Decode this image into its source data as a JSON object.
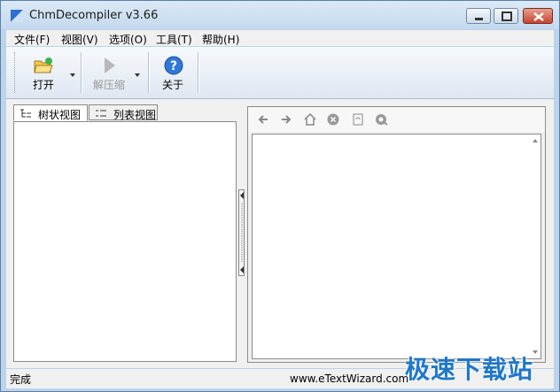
{
  "window": {
    "title": "ChmDecompiler v3.66"
  },
  "menu": {
    "items": [
      {
        "label": "文件(F)"
      },
      {
        "label": "视图(V)"
      },
      {
        "label": "选项(O)"
      },
      {
        "label": "工具(T)"
      },
      {
        "label": "帮助(H)"
      }
    ]
  },
  "toolbar": {
    "open_label": "打开",
    "decompress_label": "解压缩",
    "about_label": "关于"
  },
  "tabs": [
    {
      "label": "树状视图",
      "active": true
    },
    {
      "label": "列表视图",
      "active": false
    }
  ],
  "nav_icons": [
    "back-arrow-icon",
    "forward-arrow-icon",
    "home-icon",
    "stop-icon",
    "refresh-icon",
    "search-icon"
  ],
  "status": {
    "left": "完成",
    "right": "www.eTextWizard.com"
  },
  "watermark": "极速下载站",
  "colors": {
    "frame": "#bcd3ea",
    "close": "#c8432d",
    "watermark": "#1f78c8"
  }
}
